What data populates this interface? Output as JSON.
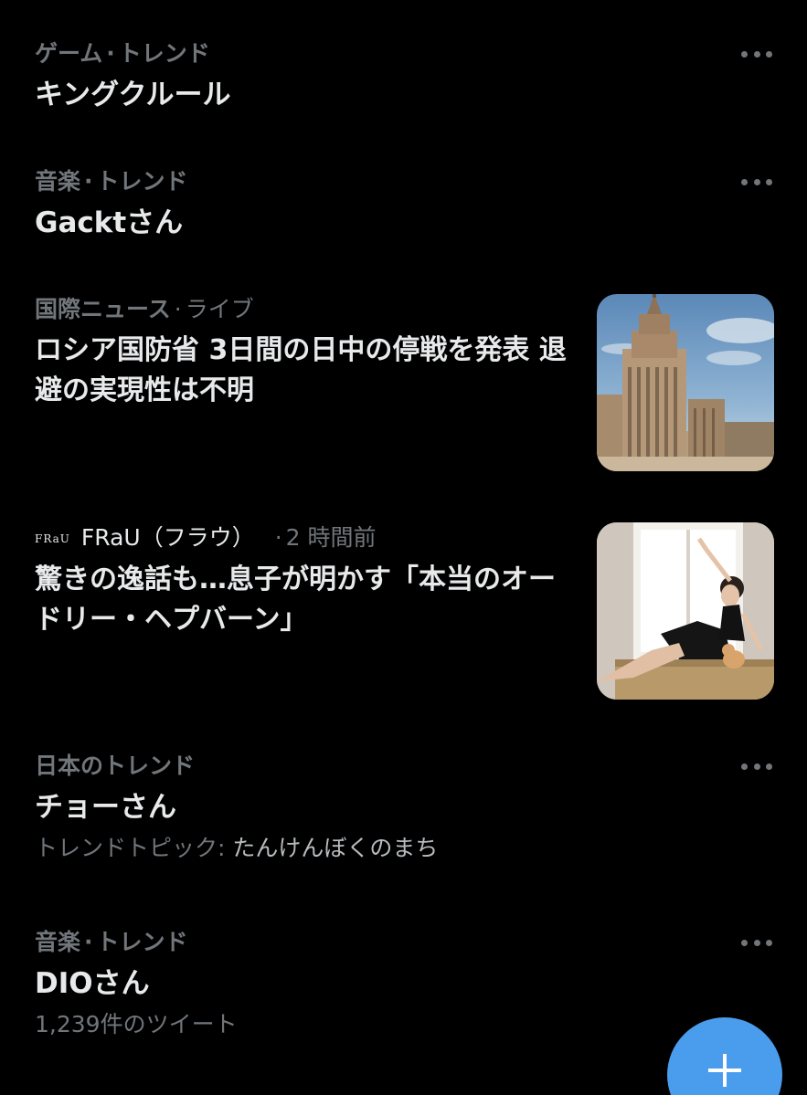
{
  "trends": [
    {
      "category": "ゲーム",
      "label": "トレンド",
      "title": "キングクルール"
    },
    {
      "category": "音楽",
      "label": "トレンド",
      "title": "Gacktさん"
    },
    {
      "category": "日本のトレンド",
      "title": "チョーさん",
      "sub_prefix": "トレンドトピック:",
      "sub_value": "たんけんぼくのまち"
    },
    {
      "category": "音楽",
      "label": "トレンド",
      "title": "DIOさん",
      "tweet_count": "1,239件のツイート"
    }
  ],
  "news": [
    {
      "category": "国際ニュース",
      "label": "ライブ",
      "title": "ロシア国防省 3日間の日中の停戦を発表 退避の実現性は不明",
      "thumbnail": "moscow-building-photo"
    },
    {
      "source_logo": "FRaU",
      "source": "FRaU（フラウ）",
      "time": "2 時間前",
      "title": "驚きの逸話も…息子が明かす「本当のオードリー・ヘプバーン」",
      "thumbnail": "woman-in-window-photo"
    }
  ],
  "separator": "·",
  "icons": {
    "more": "more-horizontal-icon",
    "compose": "plus-icon"
  },
  "colors": {
    "background": "#000000",
    "primary_text": "#e7e9ea",
    "secondary_text": "#71767b",
    "fab": "#4a9ced"
  }
}
